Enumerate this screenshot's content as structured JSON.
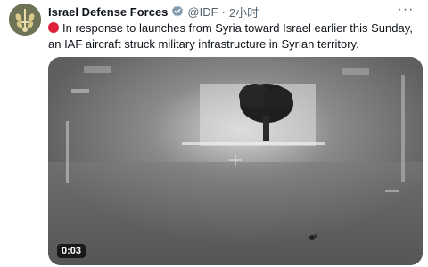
{
  "tweet": {
    "author_name": "Israel Defense Forces",
    "handle": "@IDF",
    "separator": "·",
    "time": "2小时",
    "text": "In response to launches from Syria toward Israel earlier this Sunday, an IAF aircraft struck military infrastructure in Syrian territory.",
    "more_icon": "more-horizontal-icon",
    "verified_icon": "verified-badge-icon",
    "status_icon": "red-circle-emoji"
  },
  "media": {
    "type": "video",
    "duration": "0:03"
  },
  "colors": {
    "verified": "#829aab",
    "red_dot": "#e0203a",
    "meta_text": "#536471"
  }
}
